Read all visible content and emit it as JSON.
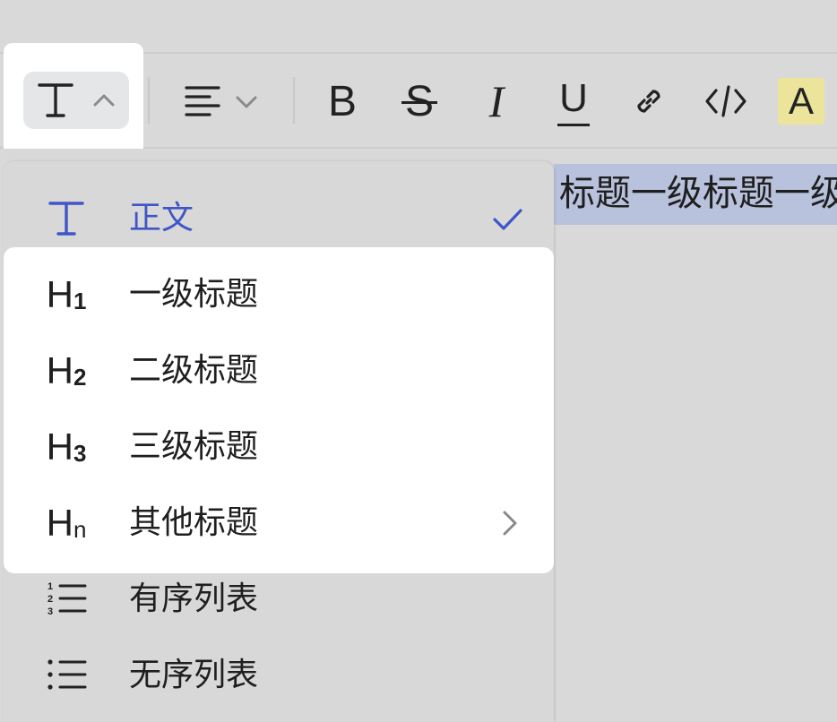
{
  "toolbar": {
    "text_style_icon": "text-T-icon",
    "text_style_chevron": "chevron-up-icon",
    "align_icon": "align-left-icon",
    "align_chevron": "chevron-down-icon",
    "bold_glyph": "B",
    "strike_glyph": "S",
    "italic_glyph": "I",
    "underline_glyph": "U",
    "link_icon": "link-icon",
    "code_icon": "code-icon",
    "highlight_glyph": "A",
    "highlight_color": "#ece49a"
  },
  "editor": {
    "selected_text": "标题一级标题一级标题"
  },
  "dropdown": {
    "accent_color": "#3f55c8",
    "items": [
      {
        "id": "body",
        "icon": "T",
        "label": "正文",
        "selected": true
      },
      {
        "id": "h1",
        "icon": "H",
        "icon_sub": "1",
        "label": "一级标题"
      },
      {
        "id": "h2",
        "icon": "H",
        "icon_sub": "2",
        "label": "二级标题"
      },
      {
        "id": "h3",
        "icon": "H",
        "icon_sub": "3",
        "label": "三级标题"
      },
      {
        "id": "hn",
        "icon": "H",
        "icon_sub": "n",
        "label": "其他标题",
        "has_submenu": true
      },
      {
        "id": "ordered-list",
        "icon": "ordered-list-icon",
        "label": "有序列表"
      },
      {
        "id": "unordered-list",
        "icon": "unordered-list-icon",
        "label": "无序列表"
      }
    ]
  }
}
